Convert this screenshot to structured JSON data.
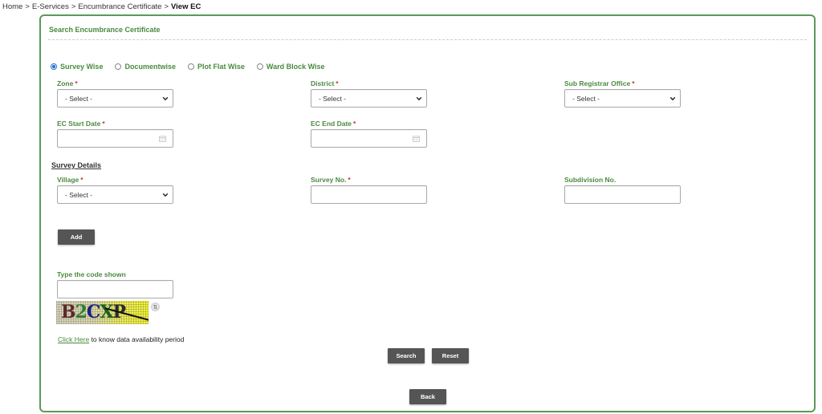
{
  "breadcrumb": {
    "items": [
      "Home",
      "E-Services",
      "Encumbrance Certificate"
    ],
    "separator": ">",
    "current": "View EC"
  },
  "panel": {
    "title": "Search Encumbrance Certificate"
  },
  "search_modes": [
    {
      "label": "Survey Wise",
      "checked": true
    },
    {
      "label": "Documentwise",
      "checked": false
    },
    {
      "label": "Plot Flat Wise",
      "checked": false
    },
    {
      "label": "Ward Block Wise",
      "checked": false
    }
  ],
  "required_marker": "*",
  "fields": {
    "zone": {
      "label": "Zone",
      "value": "- Select -"
    },
    "district": {
      "label": "District",
      "value": "- Select -"
    },
    "sro": {
      "label": "Sub Registrar Office",
      "value": "- Select -"
    },
    "ec_start": {
      "label": "EC Start Date",
      "value": ""
    },
    "ec_end": {
      "label": "EC End Date",
      "value": ""
    },
    "village": {
      "label": "Village",
      "value": "- Select -"
    },
    "survey_no": {
      "label": "Survey No.",
      "value": ""
    },
    "subdivision_no": {
      "label": "Subdivision No.",
      "value": ""
    },
    "captcha_input": {
      "label": "Type the code shown",
      "value": ""
    }
  },
  "survey_details_title": "Survey Details",
  "captcha": {
    "chars": [
      "B",
      "2",
      "C",
      "X",
      "P"
    ]
  },
  "availability": {
    "link_text": "Click Here",
    "text": " to know data availability period"
  },
  "buttons": {
    "add": "Add",
    "search": "Search",
    "reset": "Reset",
    "back": "Back"
  },
  "colors": {
    "accent_green": "#4a8a3f",
    "border_green": "#5a9a5a",
    "button_bg": "#555555",
    "radio_selected": "#1a6fd6"
  }
}
